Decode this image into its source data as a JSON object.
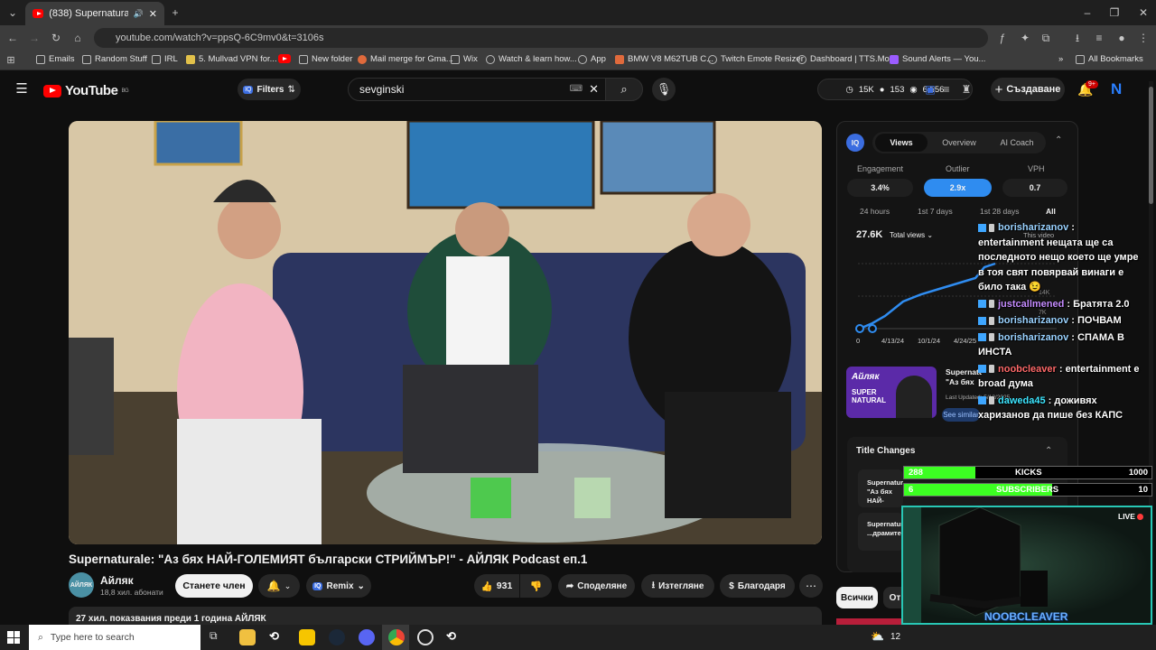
{
  "browser": {
    "tab_title": "(838) Supernaturale: \"Аз бя",
    "url": "youtube.com/watch?v=ppsQ-6C9mv0&t=3106s",
    "bookmarks": [
      "Emails",
      "Random Stuff",
      "IRL",
      "5. Mullvad VPN for...",
      "",
      "New folder",
      "Mail merge for Gma...",
      "Wix",
      "Watch & learn how...",
      "App",
      "BMW V8 M62TUB C...",
      "Twitch Emote Resizer",
      "Dashboard | TTS.Mo...",
      "Sound Alerts — You..."
    ],
    "all_bookmarks": "All Bookmarks"
  },
  "youtube": {
    "logo": "YouTube",
    "logo_region": "BG",
    "filters": "Filters",
    "search_value": "sevginski",
    "stats": {
      "a": "15K",
      "b": "153",
      "c": "6,556"
    },
    "create_label": "Създаване",
    "notif_count": "9+"
  },
  "video": {
    "title": "Supernaturale: \"Аз бях НАЙ-ГОЛЕМИЯТ български СТРИЙМЪР!\" - АЙЛЯК Podcast еп.1",
    "channel": "Айляк",
    "subscribers": "18,8 хил. абонати",
    "join_label": "Станете член",
    "remix_label": "Remix",
    "likes": "931",
    "share_label": "Споделяне",
    "download_label": "Изтегляне",
    "thanks_label": "Благодаря",
    "meta": "27 хил. показвания  преди 1 година  АЙЛЯК"
  },
  "panel": {
    "tabs": [
      "Views",
      "Overview",
      "AI Coach"
    ],
    "metrics": [
      {
        "label": "Engagement",
        "value": "3.4%"
      },
      {
        "label": "Outlier",
        "value": "2.9x"
      },
      {
        "label": "VPH",
        "value": "0.7"
      }
    ],
    "ranges": [
      "24 hours",
      "1st 7 days",
      "1st 28 days",
      "All"
    ],
    "total_views": "27.6K",
    "total_views_label": "Total views",
    "this_video": "This video",
    "y_ticks": [
      "14K",
      "7K",
      "0"
    ],
    "x_ticks": [
      "0",
      "4/13/24",
      "10/1/24",
      "4/24/25"
    ],
    "related_title": "Supernaturale: \"Аз бях НАЙ-ГОЛЕМИЯТ български...",
    "related_updated": "Last Updated: 5/12/2025",
    "see_similar": "See similar",
    "title_changes": "Title Changes",
    "change1": "Supernaturale: \"Аз бях НАЙ-ГОЛЕМИЯТ...",
    "change2": "Supernaturale: ...драмите",
    "filter_all": "Всички",
    "filter_from": "От"
  },
  "chat": [
    {
      "user": "borisharizanov",
      "color": "#9ad2ff",
      "text": "entertainment нещата ще са последното нещо което ще умре в тоя свят повярвай винаги е било така 😉"
    },
    {
      "user": "justcallmened",
      "color": "#c58cff",
      "text": "Братята 2.0"
    },
    {
      "user": "borisharizanov",
      "color": "#9ad2ff",
      "text": "ПОЧВАМ"
    },
    {
      "user": "borisharizanov",
      "color": "#9ad2ff",
      "text": "СПАМА В ИНСТА"
    },
    {
      "user": "noobcleaver",
      "color": "#ff6a6a",
      "text": "entertainment е broad дума"
    },
    {
      "user": "daweda45",
      "color": "#3ee6ff",
      "text": "доживях харизанов да пише без КАПС"
    }
  ],
  "goals": [
    {
      "current": "288",
      "label": "KICKS",
      "target": "1000",
      "fill": 0.288
    },
    {
      "current": "6",
      "label": "SUBSCRIBERS",
      "target": "10",
      "fill": 0.6
    }
  ],
  "webcam": {
    "live": "LIVE",
    "name": "NOOBCLEAVER"
  },
  "taskbar": {
    "search_placeholder": "Type here to search",
    "temp": "12"
  }
}
